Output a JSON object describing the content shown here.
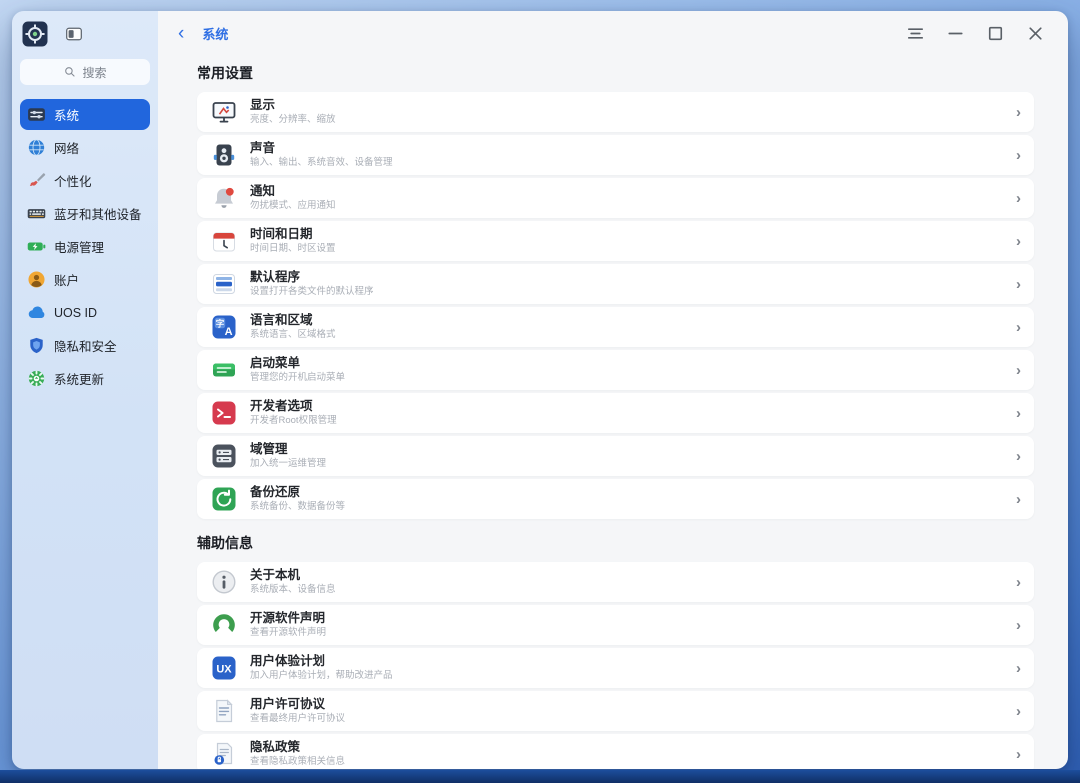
{
  "window": {
    "header": {
      "back_glyph": "‹",
      "title": "系统"
    },
    "controls": [
      {
        "name": "menu-icon"
      },
      {
        "name": "minimize-icon"
      },
      {
        "name": "maximize-icon"
      },
      {
        "name": "close-icon"
      }
    ]
  },
  "sidebar": {
    "app_icon": "control-center-logo-icon",
    "toggle_icon": "sidebar-toggle-icon",
    "search_icon": "search-icon",
    "search_placeholder": "搜索",
    "items": [
      {
        "label": "系统",
        "icon": "system-sliders-icon",
        "selected": true
      },
      {
        "label": "网络",
        "icon": "network-globe-icon",
        "selected": false
      },
      {
        "label": "个性化",
        "icon": "personalization-brush-icon",
        "selected": false
      },
      {
        "label": "蓝牙和其他设备",
        "icon": "bluetooth-devices-icon",
        "selected": false
      },
      {
        "label": "电源管理",
        "icon": "power-battery-icon",
        "selected": false
      },
      {
        "label": "账户",
        "icon": "account-icon",
        "selected": false
      },
      {
        "label": "UOS ID",
        "icon": "uos-id-cloud-icon",
        "selected": false
      },
      {
        "label": "隐私和安全",
        "icon": "privacy-shield-icon",
        "selected": false
      },
      {
        "label": "系统更新",
        "icon": "system-update-icon",
        "selected": false
      }
    ]
  },
  "main": {
    "chevron_glyph": "›",
    "sections": [
      {
        "title": "常用设置",
        "items": [
          {
            "title": "显示",
            "subtitle": "亮度、分辨率、缩放",
            "icon": "display-icon"
          },
          {
            "title": "声音",
            "subtitle": "输入、输出、系统音效、设备管理",
            "icon": "sound-speaker-icon"
          },
          {
            "title": "通知",
            "subtitle": "勿扰模式、应用通知",
            "icon": "notification-bell-icon"
          },
          {
            "title": "时间和日期",
            "subtitle": "时间日期、时区设置",
            "icon": "datetime-calendar-icon"
          },
          {
            "title": "默认程序",
            "subtitle": "设置打开各类文件的默认程序",
            "icon": "default-apps-icon"
          },
          {
            "title": "语言和区域",
            "subtitle": "系统语言、区域格式",
            "icon": "language-region-icon"
          },
          {
            "title": "启动菜单",
            "subtitle": "管理您的开机启动菜单",
            "icon": "boot-menu-icon"
          },
          {
            "title": "开发者选项",
            "subtitle": "开发者Root权限管理",
            "icon": "developer-terminal-icon"
          },
          {
            "title": "域管理",
            "subtitle": "加入统一运维管理",
            "icon": "domain-server-icon"
          },
          {
            "title": "备份还原",
            "subtitle": "系统备份、数据备份等",
            "icon": "backup-restore-icon"
          }
        ]
      },
      {
        "title": "辅助信息",
        "items": [
          {
            "title": "关于本机",
            "subtitle": "系统版本、设备信息",
            "icon": "about-info-icon"
          },
          {
            "title": "开源软件声明",
            "subtitle": "查看开源软件声明",
            "icon": "open-source-icon"
          },
          {
            "title": "用户体验计划",
            "subtitle": "加入用户体验计划，帮助改进产品",
            "icon": "ux-program-icon"
          },
          {
            "title": "用户许可协议",
            "subtitle": "查看最终用户许可协议",
            "icon": "eula-document-icon"
          },
          {
            "title": "隐私政策",
            "subtitle": "查看隐私政策相关信息",
            "icon": "privacy-policy-icon"
          }
        ]
      }
    ]
  },
  "colors": {
    "accent": "#2166dd",
    "header_title": "#2f6fe4",
    "main_background": "#f5f6f8",
    "row_background": "#ffffff",
    "sidebar_background": "#d2e2f6",
    "desktop_top": "#c3d8f3",
    "desktop_bottom": "#2f5fb4",
    "taskbar": "#102f66",
    "subtitle_text": "#a9aeb6"
  }
}
